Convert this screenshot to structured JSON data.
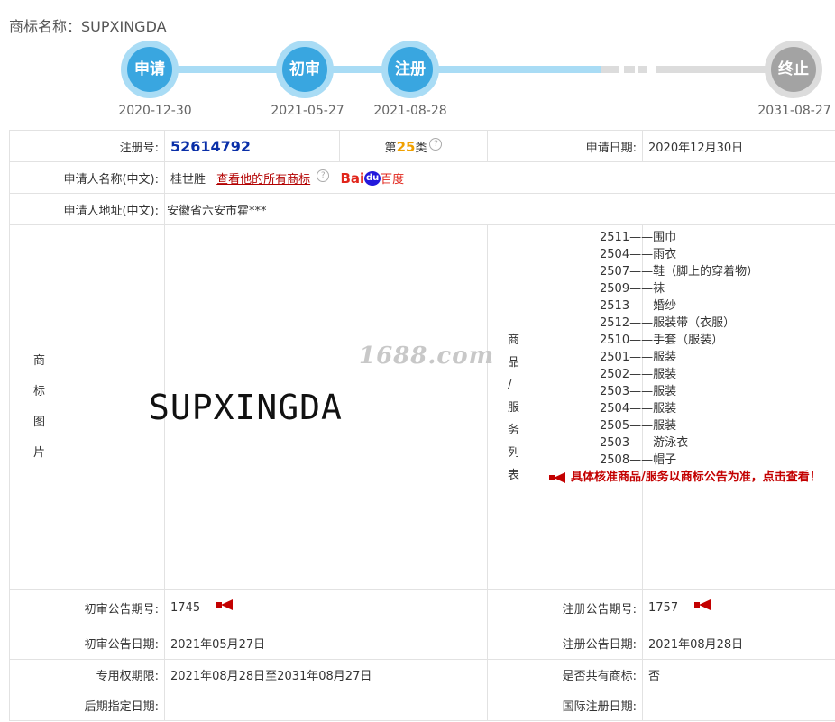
{
  "header": {
    "label": "商标名称：",
    "name": "SUPXINGDA"
  },
  "timeline": [
    {
      "label": "申请",
      "date": "2020-12-30",
      "state": "on"
    },
    {
      "label": "初审",
      "date": "2021-05-27",
      "state": "on"
    },
    {
      "label": "注册",
      "date": "2021-08-28",
      "state": "on"
    },
    {
      "label": "终止",
      "date": "2031-08-27",
      "state": "off"
    }
  ],
  "info": {
    "reg_no_label": "注册号:",
    "reg_no": "52614792",
    "class_prefix": "第",
    "class_num": "25",
    "class_suffix": "类",
    "apply_date_label": "申请日期:",
    "apply_date": "2020年12月30日",
    "applicant_label": "申请人名称(中文):",
    "applicant": "桂世胜",
    "view_all_link": "查看他的所有商标",
    "baidu_bai": "Bai",
    "baidu_paw": "du",
    "baidu_cn": "百度",
    "address_label": "申请人地址(中文):",
    "address": "安徽省六安市霍***",
    "image_label_chars": [
      "商",
      "标",
      "图",
      "片"
    ],
    "mark_text": "SUPXINGDA",
    "watermark": "1688.com",
    "goods_label_chars": [
      "商",
      "品",
      "/",
      "服",
      "务",
      "列",
      "表"
    ],
    "goods": [
      {
        "code": "2511——",
        "name": "围巾"
      },
      {
        "code": "2504——",
        "name": "雨衣"
      },
      {
        "code": "2507——",
        "name": "鞋（脚上的穿着物）"
      },
      {
        "code": "2509——",
        "name": "袜"
      },
      {
        "code": "2513——",
        "name": "婚纱"
      },
      {
        "code": "2512——",
        "name": "服装带（衣服）"
      },
      {
        "code": "2510——",
        "name": "手套（服装）"
      },
      {
        "code": "2501——",
        "name": "服装"
      },
      {
        "code": "2502——",
        "name": "服装"
      },
      {
        "code": "2503——",
        "name": "服装"
      },
      {
        "code": "2504——",
        "name": "服装"
      },
      {
        "code": "2505——",
        "name": "服装"
      },
      {
        "code": "2503——",
        "name": "游泳衣"
      },
      {
        "code": "2508——",
        "name": "帽子"
      }
    ],
    "goods_notice": "具体核准商品/服务以商标公告为准，点击查看！",
    "prelim_no_label": "初审公告期号:",
    "prelim_no": "1745",
    "reg_pub_no_label": "注册公告期号:",
    "reg_pub_no": "1757",
    "prelim_date_label": "初审公告日期:",
    "prelim_date": "2021年05月27日",
    "reg_pub_date_label": "注册公告日期:",
    "reg_pub_date": "2021年08月28日",
    "exclusive_label": "专用权期限:",
    "exclusive": "2021年08月28日至2031年08月27日",
    "shared_label": "是否共有商标:",
    "shared": "否",
    "later_label": "后期指定日期:",
    "later": "",
    "intl_label": "国际注册日期:",
    "intl": ""
  },
  "colors": {
    "accent": "#39a6e0",
    "accent_light": "#a9dcf5",
    "inactive": "#a3a3a3",
    "link": "#b30000",
    "reg_no": "#0a2fa8",
    "class": "#f0a000"
  }
}
